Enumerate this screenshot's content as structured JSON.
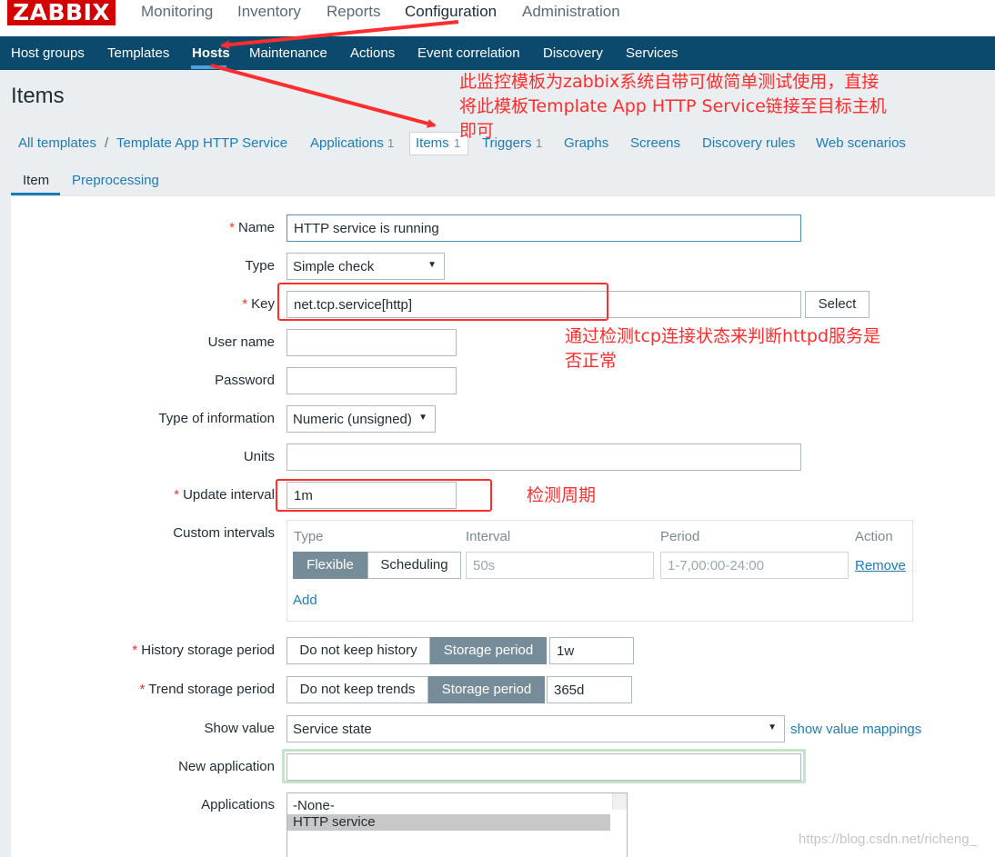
{
  "logo": "ZABBIX",
  "top_nav": [
    "Monitoring",
    "Inventory",
    "Reports",
    "Configuration",
    "Administration"
  ],
  "sub_nav": [
    "Host groups",
    "Templates",
    "Hosts",
    "Maintenance",
    "Actions",
    "Event correlation",
    "Discovery",
    "Services"
  ],
  "page_title": "Items",
  "breadcrumbs": {
    "all_templates": "All templates",
    "separator": "/",
    "template": "Template App HTTP Service",
    "applications": "Applications",
    "applications_count": "1",
    "items": "Items",
    "items_count": "1",
    "triggers": "Triggers",
    "triggers_count": "1",
    "graphs": "Graphs",
    "screens": "Screens",
    "discovery_rules": "Discovery rules",
    "web_scenarios": "Web scenarios"
  },
  "tabs": [
    "Item",
    "Preprocessing"
  ],
  "form": {
    "name": {
      "label": "Name",
      "value": "HTTP service is running"
    },
    "type": {
      "label": "Type",
      "value": "Simple check"
    },
    "key": {
      "label": "Key",
      "value": "net.tcp.service[http]",
      "button": "Select"
    },
    "user_name": {
      "label": "User name",
      "value": ""
    },
    "password": {
      "label": "Password",
      "value": ""
    },
    "type_of_information": {
      "label": "Type of information",
      "value": "Numeric (unsigned)"
    },
    "units": {
      "label": "Units",
      "value": ""
    },
    "update_interval": {
      "label": "Update interval",
      "value": "1m"
    },
    "custom_intervals": {
      "label": "Custom intervals",
      "headers": [
        "Type",
        "Interval",
        "Period",
        "Action"
      ],
      "flexible": "Flexible",
      "scheduling": "Scheduling",
      "interval_placeholder": "50s",
      "period_placeholder": "1-7,00:00-24:00",
      "remove": "Remove",
      "add": "Add"
    },
    "history": {
      "label": "History storage period",
      "option_off": "Do not keep history",
      "option_on": "Storage period",
      "value": "1w"
    },
    "trends": {
      "label": "Trend storage period",
      "option_off": "Do not keep trends",
      "option_on": "Storage period",
      "value": "365d"
    },
    "show_value": {
      "label": "Show value",
      "value": "Service state",
      "link": "show value mappings"
    },
    "new_application": {
      "label": "New application",
      "value": ""
    },
    "applications": {
      "label": "Applications",
      "options": [
        "-None-",
        "HTTP service"
      ]
    }
  },
  "annotations": {
    "template_note_line1": "此监控模板为zabbix系统自带可做简单测试使用，直接",
    "template_note_line2": "将此模板Template App HTTP Service链接至目标主机",
    "template_note_line3": "即可",
    "key_note_line1": "通过检测tcp连接状态来判断httpd服务是",
    "key_note_line2": "否正常",
    "interval_note": "检测周期"
  },
  "watermark": "https://blog.csdn.net/richeng_",
  "colors": {
    "header_bar": "#0b4a6d",
    "logo_red": "#d40000",
    "link_blue": "#1d7bb8",
    "annotation_red": "#ff2d2d",
    "active_button": "#768d99"
  }
}
